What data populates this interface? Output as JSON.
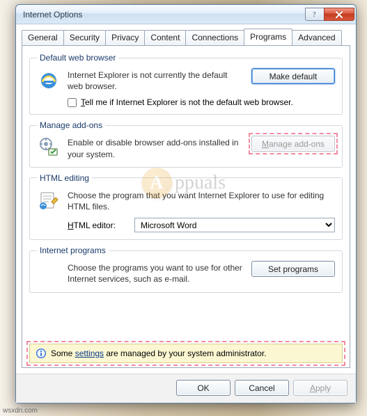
{
  "window": {
    "title": "Internet Options"
  },
  "tabs": [
    "General",
    "Security",
    "Privacy",
    "Content",
    "Connections",
    "Programs",
    "Advanced"
  ],
  "active_tab_index": 5,
  "groups": {
    "default_browser": {
      "legend": "Default web browser",
      "desc": "Internet Explorer is not currently the default web browser.",
      "button": "Make default",
      "check_label": "Tell me if Internet Explorer is not the default web browser.",
      "check_accel": "T"
    },
    "addons": {
      "legend": "Manage add-ons",
      "desc": "Enable or disable browser add-ons installed in your system.",
      "button": "Manage add-ons",
      "button_accel": "M"
    },
    "html_editing": {
      "legend": "HTML editing",
      "desc": "Choose the program that you want Internet Explorer to use for editing HTML files.",
      "editor_label": "HTML editor:",
      "editor_accel": "H",
      "editor_value": "Microsoft Word"
    },
    "internet_programs": {
      "legend": "Internet programs",
      "desc": "Choose the programs you want to use for other Internet services, such as e-mail.",
      "button": "Set programs"
    }
  },
  "admin_bar": {
    "prefix": "Some ",
    "link": "settings",
    "suffix": " are managed by your system administrator."
  },
  "dialog_buttons": {
    "ok": "OK",
    "cancel": "Cancel",
    "apply": "Apply",
    "accel_a": "A"
  },
  "watermark": "ppuals",
  "domain_text": "wsxdn.com"
}
